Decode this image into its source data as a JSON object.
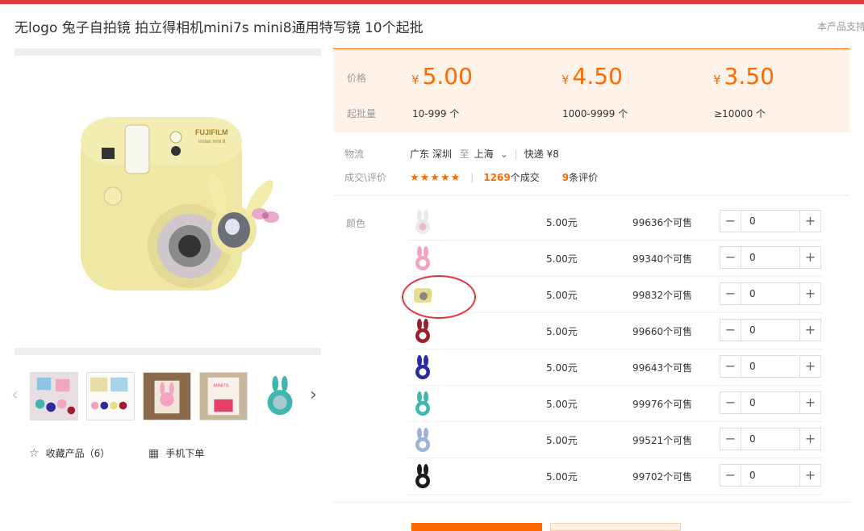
{
  "header": {
    "title": "无logo 兔子自拍镜 拍立得相机mini7s mini8通用特写镜 10个起批",
    "support_text": "本产品支持"
  },
  "gallery": {
    "favorite_label": "收藏产品（6）",
    "mobile_order_label": "手机下单",
    "camera_brand": "FUJIFILM",
    "camera_model": "instax mini 8",
    "thumb_text": "MINI7S"
  },
  "pricing": {
    "price_label": "价格",
    "moq_label": "起批量",
    "currency": "¥",
    "tiers": [
      {
        "price": "5.00",
        "range": "10-999 个"
      },
      {
        "price": "4.50",
        "range": "1000-9999 个"
      },
      {
        "price": "3.50",
        "range": "≥10000 个"
      }
    ]
  },
  "logistics": {
    "label": "物流",
    "from": "广东 深圳",
    "to_word": "至",
    "to": "上海",
    "express": "快递 ¥8"
  },
  "deals": {
    "label": "成交\\评价",
    "stars": "★★★★★",
    "deals_count": "1269",
    "deals_suffix": "个成交",
    "reviews_count": "9",
    "reviews_suffix": "条评价"
  },
  "sku": {
    "color_label": "颜色",
    "rows": [
      {
        "price": "5.00元",
        "stock": "99636个可售",
        "qty": "0",
        "swatch_color": "#e9e9ee",
        "accent": "#f2b6c9"
      },
      {
        "price": "5.00元",
        "stock": "99340个可售",
        "qty": "0",
        "swatch_color": "#f4a3c1",
        "accent": "#ffffff"
      },
      {
        "price": "5.00元",
        "stock": "99832个可售",
        "qty": "0",
        "swatch_color": "#e8dd8a",
        "accent": "#888888"
      },
      {
        "price": "5.00元",
        "stock": "99660个可售",
        "qty": "0",
        "swatch_color": "#9c1d2e",
        "accent": "#ffffff"
      },
      {
        "price": "5.00元",
        "stock": "99643个可售",
        "qty": "0",
        "swatch_color": "#2b2aa0",
        "accent": "#ffffff"
      },
      {
        "price": "5.00元",
        "stock": "99976个可售",
        "qty": "0",
        "swatch_color": "#3fb7b0",
        "accent": "#ffffff"
      },
      {
        "price": "5.00元",
        "stock": "99521个可售",
        "qty": "0",
        "swatch_color": "#9cb2d8",
        "accent": "#ffffff"
      },
      {
        "price": "5.00元",
        "stock": "99702个可售",
        "qty": "0",
        "swatch_color": "#1c1c1c",
        "accent": "#ffffff"
      }
    ]
  },
  "colors": {
    "accent": "#ff6a00",
    "topbar": "#e4393c",
    "panel_bg": "#fff2e8",
    "annotation": "#d9383c"
  }
}
